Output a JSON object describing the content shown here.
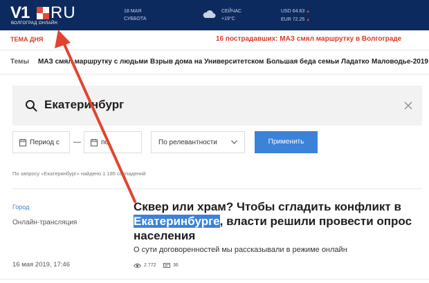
{
  "header": {
    "logo_main": "V1",
    "logo_suffix": "RU",
    "logo_sub": "ВОЛГОГРАД ОНЛАЙН",
    "date_day": "18 МАЯ",
    "date_weekday": "СУББОТА",
    "weather_label": "СЕЙЧАС",
    "weather_temp": "+19°С",
    "usd": "USD 64.63",
    "eur": "EUR 72.25",
    "brand_red": "#e34a3b",
    "background": "#0d2a5e"
  },
  "topic": {
    "label": "ТЕМА ДНЯ",
    "headline": "16 пострадавших: МАЗ смял маршрутку в Волгограде"
  },
  "nav": {
    "items": [
      "Темы",
      "МАЗ смял маршрутку с людьми",
      "Взрыв дома на Университетском",
      "Большая беда семьи Ладатко",
      "Маловодье-2019"
    ]
  },
  "search": {
    "query": "Екатеринбург",
    "period_from": "Период с",
    "period_to": "по",
    "sort": "По релевантности",
    "apply": "Применить",
    "result_count": "По запросу «Екатеринбург» найдено 1 185 совпадений"
  },
  "result": {
    "rubric": "Город",
    "format": "Онлайн-трансляция",
    "date": "16 мая 2019, 17:46",
    "title_before": "Сквер или храм? Чтобы сгладить конфликт в ",
    "title_highlight": "Екатеринбурге",
    "title_after": ", власти решили провести опрос населения",
    "snippet": "О сути договоренностей мы рассказывали в режиме онлайн",
    "views": "2 772",
    "comments": "36",
    "highlight_color": "#3b82d9"
  },
  "annotation": {
    "arrow_color": "#e0452f"
  }
}
